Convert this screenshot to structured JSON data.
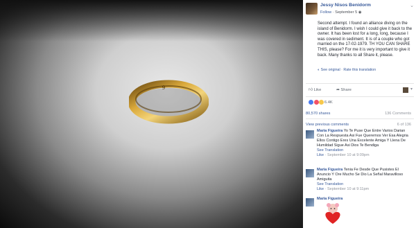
{
  "post": {
    "page_name": "Jessy Nisos Benidorm",
    "follow_label": "Follow",
    "date": "September 5",
    "text": "Second attempt. I found an alliance diving on the island of Benidorm. I wish I could give it back to the owner. It has been lost for a long, long, because I was covered in sediment. It is of a couple who got married on the 17-02-1979. TH YOU CAN SHARE THIS, please? For me it is very important to give it back. Many thanks to all Share it, please.",
    "see_original": "See original",
    "rate_translation": "Rate this translation"
  },
  "actions": {
    "like": "Like",
    "share": "Share"
  },
  "reactions": {
    "count": "6.4K"
  },
  "stats": {
    "shares": "80,570 shares",
    "comments": "136 Comments"
  },
  "previous": {
    "label": "View previous comments",
    "count": "6 of 136"
  },
  "comments": [
    {
      "name": "Maria Figueira",
      "text": "Yo Te Puse Que Entre Varios Darian Con La Respuesta Asi Fue Queremos Ver Esa Alegria Ellos Contigo Eres Una Excelente Amiga Y Llena De Humildad Sigue Asi Dios Te Bendiga",
      "see_translation": "See Translation",
      "like": "Like",
      "time": "September 10 at 9:09pm"
    },
    {
      "name": "Maria Figueira",
      "text": "Tenia Fe Desde Que Pusistes El Anuncio Y Ore Mucho Se Dio La Señal Maravilloso Amiguita",
      "see_translation": "See Translation",
      "like": "Like",
      "time": "September 10 at 9:11pm"
    },
    {
      "name": "Maria Figueira"
    }
  ]
}
